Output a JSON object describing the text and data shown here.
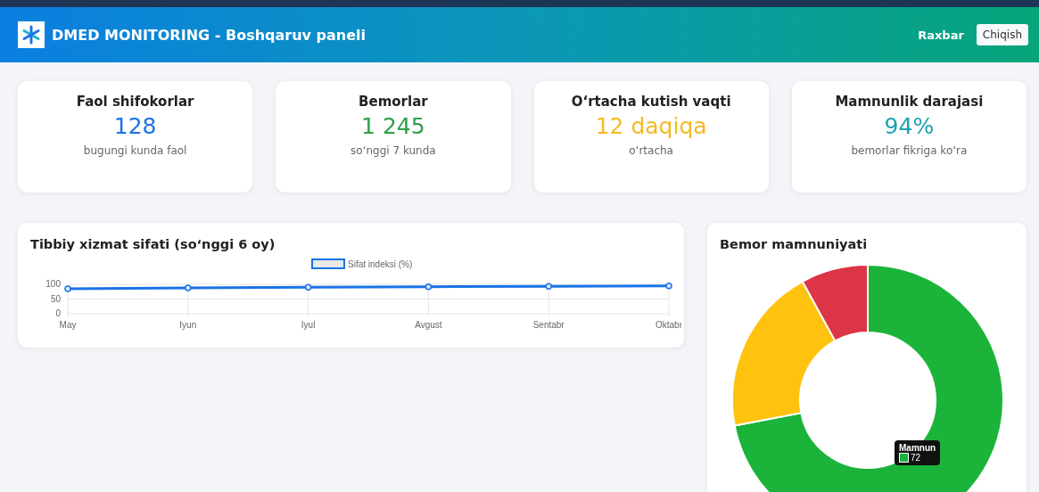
{
  "header": {
    "title": "DMED MONITORING - Boshqaruv paneli",
    "user": "Raxbar",
    "logout": "Chiqish"
  },
  "stats": [
    {
      "title": "Faol shifokorlar",
      "value": "128",
      "note": "bugungi kunda faol",
      "color": "#1a73e8"
    },
    {
      "title": "Bemorlar",
      "value": "1 245",
      "note": "so‘nggi 7 kunda",
      "color": "#2e9e48"
    },
    {
      "title": "O‘rtacha kutish vaqti",
      "value": "12 daqiqa",
      "note": "o‘rtacha",
      "color": "#f5b921"
    },
    {
      "title": "Mamnunlik darajasi",
      "value": "94%",
      "note": "bemorlar fikriga ko‘ra",
      "color": "#1ba1b5"
    }
  ],
  "quality": {
    "title": "Tibbiy xizmat sifati (so‘nggi 6 oy)",
    "chart_data": {
      "type": "line",
      "categories": [
        "May",
        "Iyun",
        "Iyul",
        "Avgust",
        "Sentabr",
        "Oktabr"
      ],
      "series": [
        {
          "name": "Sifat indeksi (%)",
          "color": "#1a73e8",
          "values": [
            85,
            88,
            90,
            92,
            93,
            95
          ]
        }
      ],
      "ylim": [
        0,
        100
      ],
      "yticks": [
        0,
        50,
        100
      ],
      "grid": true,
      "marker": true
    }
  },
  "satisfaction": {
    "title": "Bemor mamnuniyati",
    "chart_data": {
      "type": "donut",
      "values": [
        72,
        20,
        8
      ],
      "colors": [
        "#1cb33a",
        "#ffc20e",
        "#dc3545"
      ]
    },
    "tooltip": {
      "title": "Mamnun",
      "value": "72"
    }
  }
}
